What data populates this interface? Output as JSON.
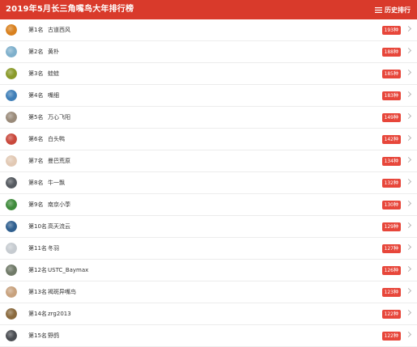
{
  "header": {
    "title": "2019年5月长三角嘴鸟大年排行榜",
    "history_label": "历史排行",
    "menu_icon": "menu-icon",
    "bg_color": "#d93a2b"
  },
  "badge_color": "#e7463a",
  "entries": [
    {
      "rank": "第1名",
      "name": "古道西风",
      "count": "193种",
      "avatar_color": "#d9811f"
    },
    {
      "rank": "第2名",
      "name": "黄朴",
      "count": "188种",
      "avatar_color": "#7fb0cc"
    },
    {
      "rank": "第3名",
      "name": "蛙蛙",
      "count": "185种",
      "avatar_color": "#8a9a2a"
    },
    {
      "rank": "第4名",
      "name": "嘴细",
      "count": "183种",
      "avatar_color": "#3f7fb8"
    },
    {
      "rank": "第5名",
      "name": "万心飞阳",
      "count": "149种",
      "avatar_color": "#9a8b7a"
    },
    {
      "rank": "第6名",
      "name": "白头鸭",
      "count": "142种",
      "avatar_color": "#c9483c"
    },
    {
      "rank": "第7名",
      "name": "曼巴荒原",
      "count": "134种",
      "avatar_color": "#e2c9b4"
    },
    {
      "rank": "第8名",
      "name": "牛一飘",
      "count": "132种",
      "avatar_color": "#555a60"
    },
    {
      "rank": "第9名",
      "name": "南京小荸",
      "count": "130种",
      "avatar_color": "#3f8b3c"
    },
    {
      "rank": "第10名",
      "name": "高天流云",
      "count": "129种",
      "avatar_color": "#2f5f8f"
    },
    {
      "rank": "第11名",
      "name": "冬羽",
      "count": "127种",
      "avatar_color": "#c6cbd0"
    },
    {
      "rank": "第12名",
      "name": "USTC_Baymax",
      "count": "126种",
      "avatar_color": "#707a68"
    },
    {
      "rank": "第13名",
      "name": "褐斑异嘴鸟",
      "count": "123种",
      "avatar_color": "#c8a27e"
    },
    {
      "rank": "第14名",
      "name": "zrg2013",
      "count": "122种",
      "avatar_color": "#8a6a3e"
    },
    {
      "rank": "第15名",
      "name": "野鸽",
      "count": "122种",
      "avatar_color": "#4a4d52"
    }
  ]
}
